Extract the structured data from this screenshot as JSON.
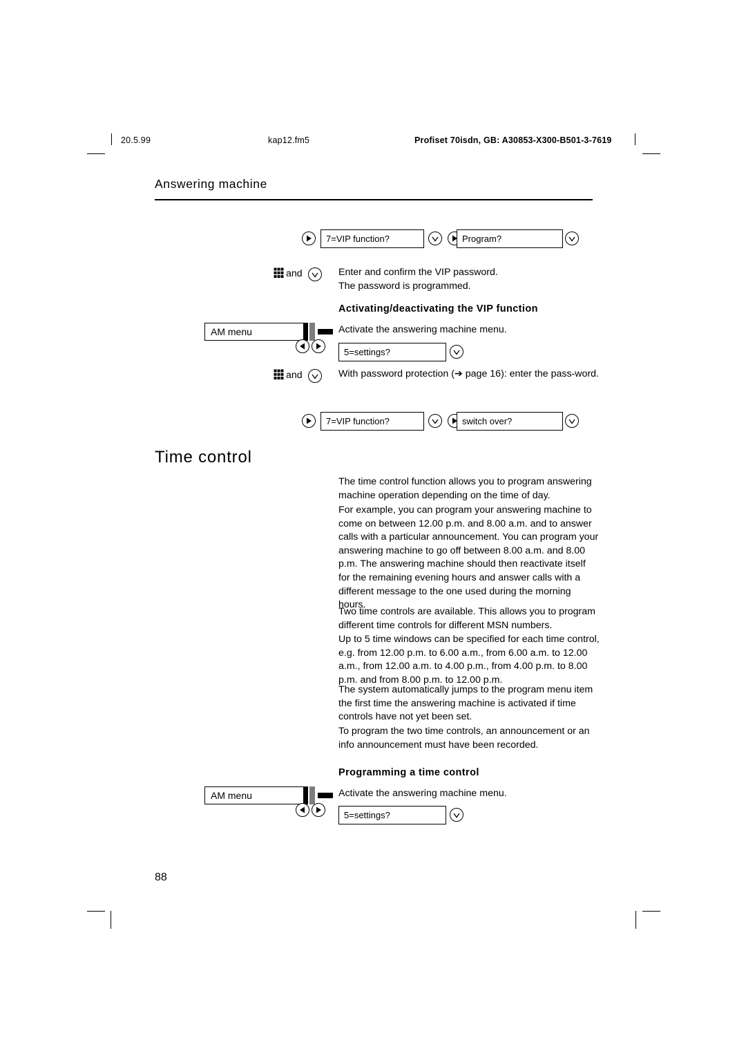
{
  "header": {
    "date": "20.5.99",
    "filename": "kap12.fm5",
    "document": "Profiset 70isdn, GB: A30853-X300-B501-3-7619"
  },
  "running_title": "Answering machine",
  "page_number": "88",
  "blocks": {
    "row1": {
      "display1": "7=VIP function?",
      "display2": "Program?"
    },
    "enter_password": {
      "and_label": "and",
      "text_line1": "Enter and confirm the VIP password.",
      "text_line2": "The password is programmed."
    },
    "subheading_activating": "Activating/deactivating the VIP function",
    "am_menu_1": {
      "label": "AM menu",
      "instruction": "Activate the answering machine menu.",
      "display_settings": "5=settings?"
    },
    "password_protection": {
      "and_label": "and",
      "text": "With password protection (➔ page 16): enter the pass-word."
    },
    "row2": {
      "display1": "7=VIP function?",
      "display2": "switch over?"
    }
  },
  "time_control": {
    "heading": "Time control",
    "paragraphs": [
      "The time control function allows you to program answering machine operation depending on the time of day.",
      "For example, you can program your answering machine to come on between 12.00 p.m. and 8.00 a.m. and to answer calls with a particular announcement. You can program your answering machine to go off between 8.00 a.m. and 8.00 p.m. The answering machine should then reactivate itself for the remaining evening hours and answer calls with a different message to the one used during the morning hours.",
      "Two time controls are available. This allows you to program different time controls for different MSN numbers.",
      "Up to 5 time windows can be specified for each time control, e.g. from 12.00 p.m. to 6.00 a.m., from 6.00 a.m. to 12.00 a.m., from 12.00 a.m. to 4.00 p.m., from 4.00 p.m. to 8.00 p.m. and from 8.00 p.m. to 12.00 p.m.",
      "The system automatically jumps to the program menu item the first time the answering machine is activated if time controls have not yet been set.",
      "To program the two time controls, an announcement or an info announcement must have been recorded."
    ],
    "subheading_programming": "Programming a time control",
    "am_menu_2": {
      "label": "AM menu",
      "instruction": "Activate the answering machine menu.",
      "display_settings": "5=settings?"
    }
  },
  "icons": {
    "right_arrow_key": "right-arrow-key-icon",
    "left_arrow_key": "left-arrow-key-icon",
    "check_key": "confirm-key-icon",
    "keypad": "keypad-icon"
  }
}
